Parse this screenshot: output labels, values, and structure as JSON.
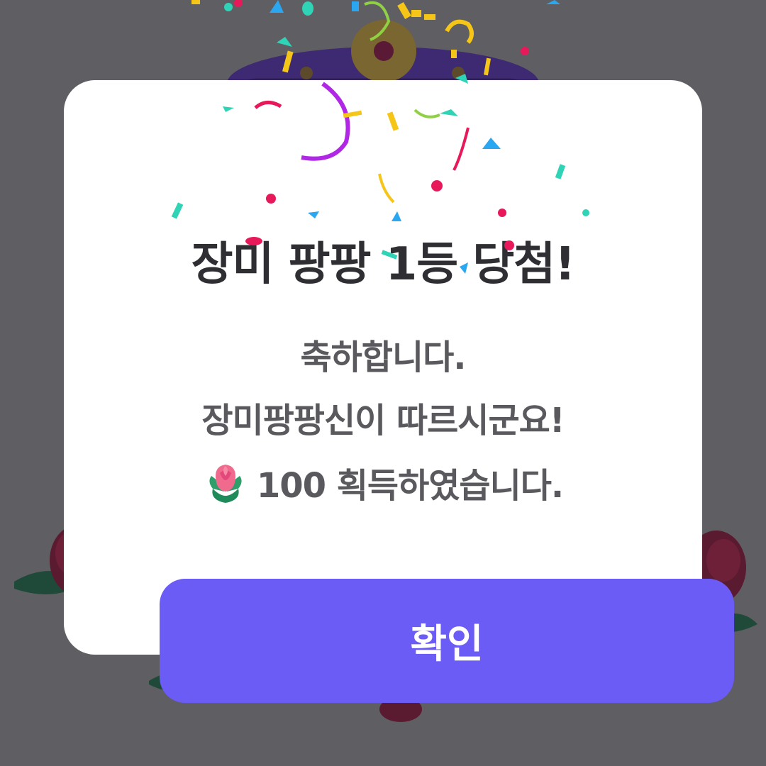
{
  "dialog": {
    "title": "장미 팡팡 1등 당첨!",
    "line1": "축하합니다.",
    "line2": "장미팡팡신이 따르시군요!",
    "reward_amount": "100",
    "reward_suffix": " 획득하였습니다.",
    "reward_icon": "rose-icon",
    "confirm_label": "확인"
  },
  "colors": {
    "overlay": "#5f5e62",
    "dialog_bg": "#ffffff",
    "accent": "#6a5cf5",
    "title_text": "#2f2f33",
    "body_text": "#5a5a5e"
  }
}
